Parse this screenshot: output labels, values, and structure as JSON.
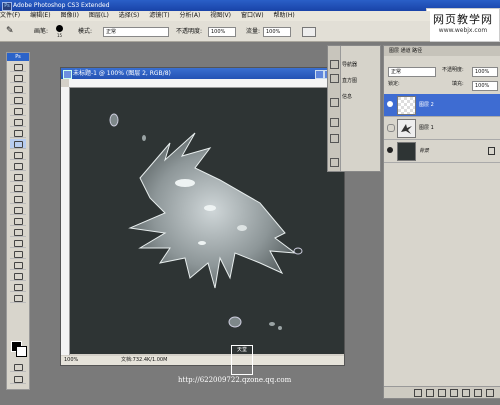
{
  "title_bar": {
    "app_title": "Adobe Photoshop CS3 Extended",
    "ps_badge": "Ps"
  },
  "watermark": {
    "line1": "网页教学网",
    "line2": "www.webjx.com"
  },
  "menu": [
    "文件(F)",
    "编辑(E)",
    "图像(I)",
    "图层(L)",
    "选择(S)",
    "滤镜(T)",
    "分析(A)",
    "视图(V)",
    "窗口(W)",
    "帮助(H)"
  ],
  "options_bar": {
    "brush_label": "画笔:",
    "brush_size": "15",
    "mode_label": "模式:",
    "mode_value": "正常",
    "opacity_label": "不透明度:",
    "opacity_value": "100%",
    "flow_label": "流量:",
    "flow_value": "100%"
  },
  "toolbox": {
    "header": "Ps"
  },
  "document": {
    "title": "未标题-1 @ 100% (图层 2, RGB/8)",
    "zoom": "100%",
    "doc_size": "文档:732.4K/1.00M"
  },
  "nav_panel": {
    "items": [
      "导航器",
      "直方图",
      "信息"
    ]
  },
  "layers_panel": {
    "tabs": "图层 通道 路径",
    "blend_mode": "正常",
    "opacity_label": "不透明度:",
    "opacity_value": "100%",
    "lock_label": "锁定:",
    "fill_label": "填充:",
    "fill_value": "100%",
    "layers": [
      {
        "name": "图层 2",
        "selected": true
      },
      {
        "name": "图层 1",
        "selected": false
      },
      {
        "name": "背景",
        "selected": false
      }
    ]
  },
  "footer": {
    "url": "http://622009722.qzone.qq.com",
    "seal": "天堂"
  }
}
